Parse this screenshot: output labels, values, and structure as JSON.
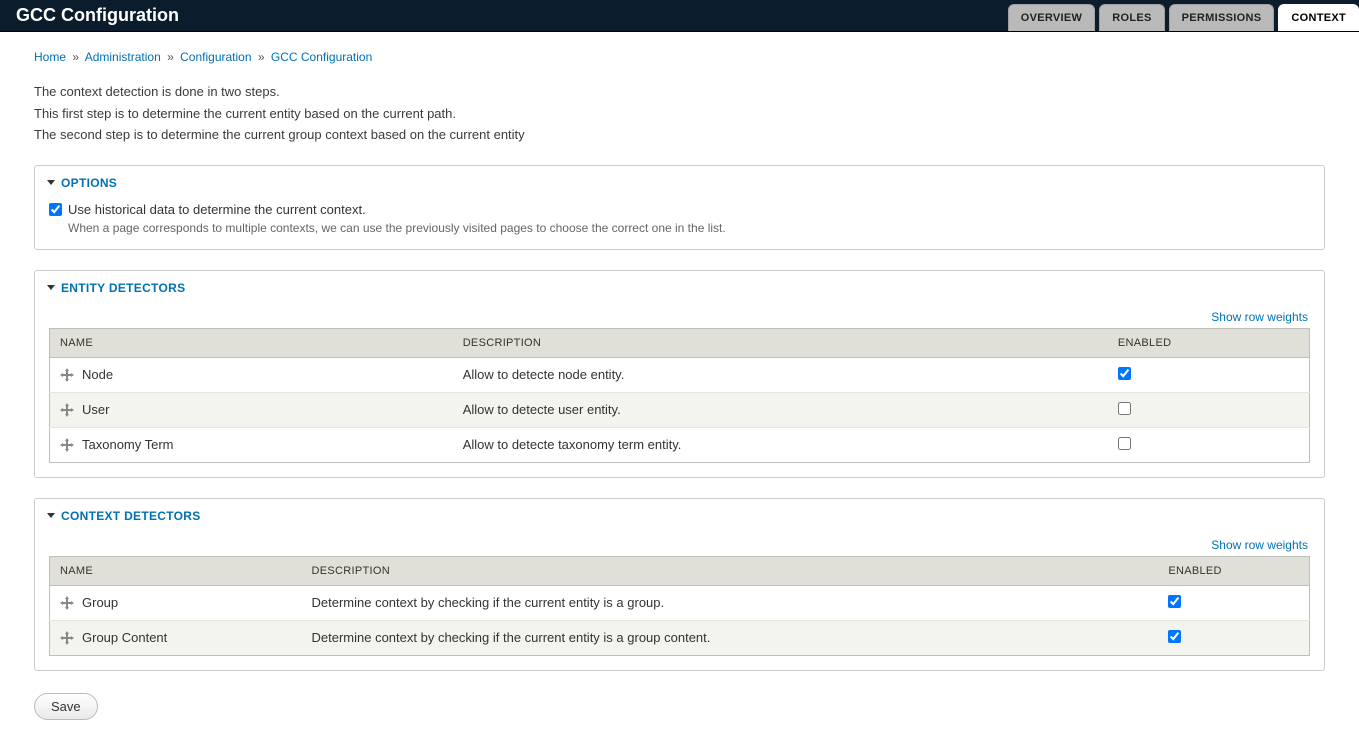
{
  "header": {
    "title": "GCC Configuration"
  },
  "tabs": [
    {
      "label": "OVERVIEW",
      "active": false
    },
    {
      "label": "ROLES",
      "active": false
    },
    {
      "label": "PERMISSIONS",
      "active": false
    },
    {
      "label": "CONTEXT",
      "active": true
    }
  ],
  "breadcrumb": {
    "items": [
      "Home",
      "Administration",
      "Configuration",
      "GCC Configuration"
    ],
    "sep": "»"
  },
  "intro": {
    "line1": "The context detection is done in two steps.",
    "line2": "This first step is to determine the current entity based on the current path.",
    "line3": "The second step is to determine the current group context based on the current entity"
  },
  "options_section": {
    "title": "Options",
    "checkbox_label": "Use historical data to determine the current context.",
    "checkbox_checked": true,
    "description": "When a page corresponds to multiple contexts, we can use the previously visited pages to choose the correct one in the list."
  },
  "entity_section": {
    "title": "Entity Detectors",
    "show_weights": "Show row weights",
    "columns": {
      "name": "NAME",
      "description": "DESCRIPTION",
      "enabled": "ENABLED"
    },
    "rows": [
      {
        "name": "Node",
        "description": "Allow to detecte node entity.",
        "enabled": true
      },
      {
        "name": "User",
        "description": "Allow to detecte user entity.",
        "enabled": false
      },
      {
        "name": "Taxonomy Term",
        "description": "Allow to detecte taxonomy term entity.",
        "enabled": false
      }
    ]
  },
  "context_section": {
    "title": "Context Detectors",
    "show_weights": "Show row weights",
    "columns": {
      "name": "NAME",
      "description": "DESCRIPTION",
      "enabled": "ENABLED"
    },
    "rows": [
      {
        "name": "Group",
        "description": "Determine context by checking if the current entity is a group.",
        "enabled": true
      },
      {
        "name": "Group Content",
        "description": "Determine context by checking if the current entity is a group content.",
        "enabled": true
      }
    ]
  },
  "buttons": {
    "save": "Save"
  }
}
